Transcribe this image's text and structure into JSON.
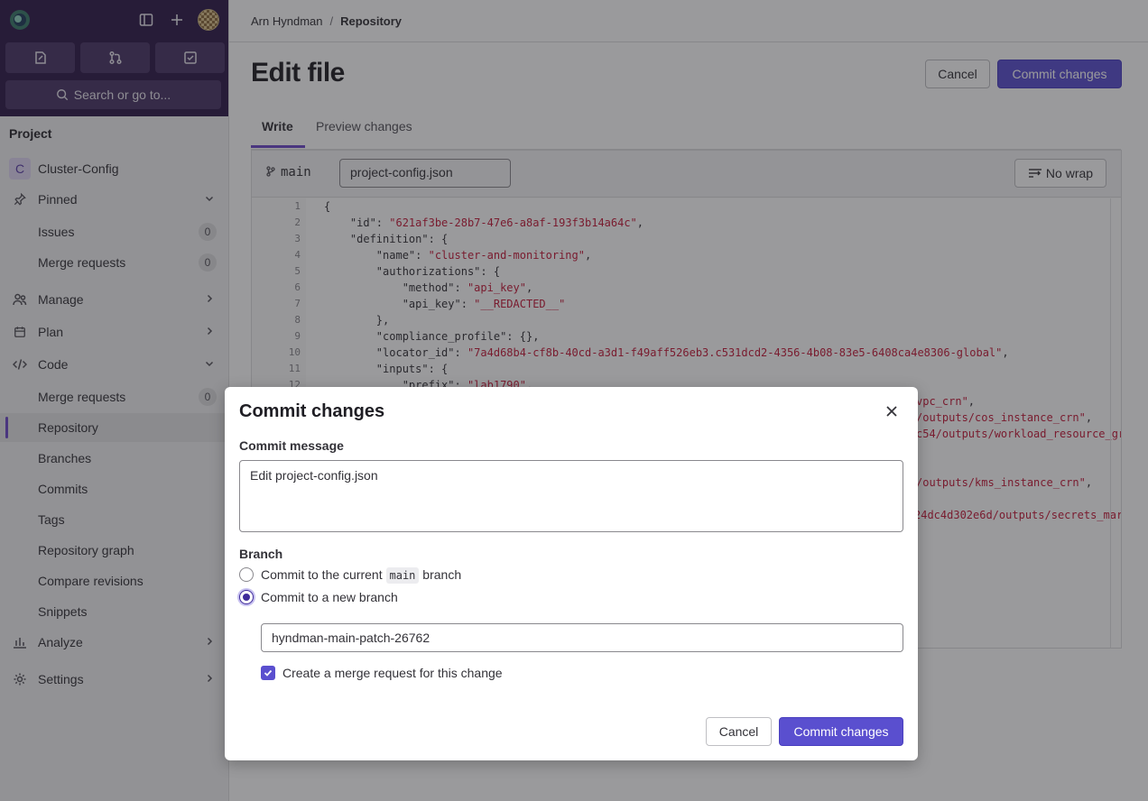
{
  "sidebar": {
    "search_label": "Search or go to...",
    "section_title": "Project",
    "project_initial": "C",
    "project_name": "Cluster-Config",
    "pinned": "Pinned",
    "issues": "Issues",
    "issues_count": "0",
    "merge_requests": "Merge requests",
    "merge_requests_count": "0",
    "manage": "Manage",
    "plan": "Plan",
    "code": "Code",
    "code_merge_requests": "Merge requests",
    "code_merge_requests_count": "0",
    "repository": "Repository",
    "branches": "Branches",
    "commits": "Commits",
    "tags": "Tags",
    "repository_graph": "Repository graph",
    "compare_revisions": "Compare revisions",
    "snippets": "Snippets",
    "analyze": "Analyze",
    "settings": "Settings"
  },
  "breadcrumb": {
    "user": "Arn Hyndman",
    "separator": "/",
    "current": "Repository"
  },
  "page": {
    "title": "Edit file",
    "cancel": "Cancel",
    "commit": "Commit changes",
    "tab_write": "Write",
    "tab_preview": "Preview changes"
  },
  "editor": {
    "branch": "main",
    "filename": "project-config.json",
    "nowrap": "No wrap",
    "lines": [
      {
        "n": "1",
        "t": "{"
      },
      {
        "n": "2",
        "t": "    \"id\": ",
        "s": "\"621af3be-28b7-47e6-a8af-193f3b14a64c\"",
        "e": ","
      },
      {
        "n": "3",
        "t": "    \"definition\": {"
      },
      {
        "n": "4",
        "t": "        \"name\": ",
        "s": "\"cluster-and-monitoring\"",
        "e": ","
      },
      {
        "n": "5",
        "t": "        \"authorizations\": {"
      },
      {
        "n": "6",
        "t": "            \"method\": ",
        "s": "\"api_key\"",
        "e": ","
      },
      {
        "n": "7",
        "t": "            \"api_key\": ",
        "s": "\"__REDACTED__\"",
        "e": ""
      },
      {
        "n": "8",
        "t": "        },"
      },
      {
        "n": "9",
        "t": "        \"compliance_profile\": {},"
      },
      {
        "n": "10",
        "t": "        \"locator_id\": ",
        "s": "\"7a4d68b4-cf8b-40cd-a3d1-f49aff526eb3.c531dcd2-4356-4b08-83e5-6408ca4e8306-global\"",
        "e": ","
      },
      {
        "n": "11",
        "t": "        \"inputs\": {"
      },
      {
        "n": "12",
        "t": "            \"prefix\": ",
        "s": "\"lab1790\"",
        "e": ","
      }
    ],
    "fragments": [
      {
        "s": "vpc_crn\"",
        "e": ","
      },
      {
        "s": "/outputs/cos_instance_crn\"",
        "e": ","
      },
      {
        "s": "c54/outputs/workload_resource_gr",
        "e": ""
      },
      {
        "s": "/outputs/kms_instance_crn\"",
        "e": ","
      },
      {
        "s": "24dc4d302e6d/outputs/secrets_mar",
        "e": ""
      }
    ]
  },
  "modal": {
    "title": "Commit changes",
    "message_label": "Commit message",
    "message_value": "Edit project-config.json",
    "branch_label": "Branch",
    "radio_current_pre": "Commit to the current",
    "radio_current_code": "main",
    "radio_current_post": "branch",
    "radio_new": "Commit to a new branch",
    "new_branch_value": "hyndman-main-patch-26762",
    "create_mr": "Create a merge request for this change",
    "cancel": "Cancel",
    "commit": "Commit changes"
  }
}
